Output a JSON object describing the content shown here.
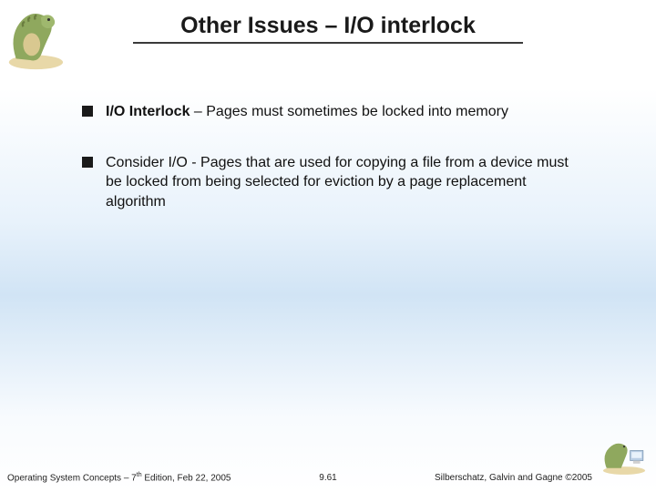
{
  "title": "Other Issues – I/O interlock",
  "bullets": [
    {
      "bold": "I/O Interlock",
      "rest": " – Pages must sometimes be locked into memory"
    },
    {
      "bold": "",
      "rest": "Consider I/O - Pages that are used for copying a file from a device must be locked from being selected for eviction by a page replacement algorithm"
    }
  ],
  "footer": {
    "left_a": "Operating System Concepts – 7",
    "left_sup": "th",
    "left_b": " Edition, Feb 22, 2005",
    "center": "9.61",
    "right": "Silberschatz, Galvin and Gagne ©2005"
  }
}
